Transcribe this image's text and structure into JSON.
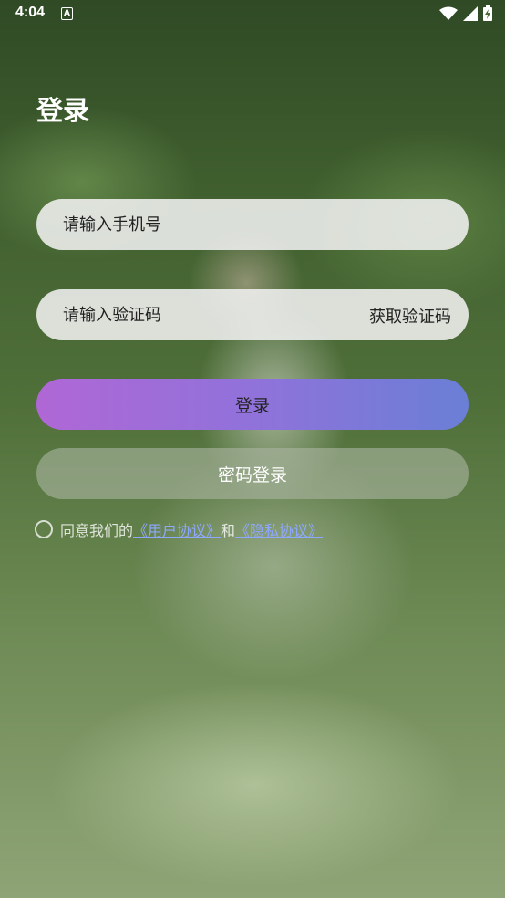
{
  "status_bar": {
    "time": "4:04",
    "notif_glyph": "A"
  },
  "title": "登录",
  "phone_input": {
    "placeholder": "请输入手机号"
  },
  "code_input": {
    "placeholder": "请输入验证码",
    "get_code_label": "获取验证码"
  },
  "login_button": {
    "label": "登录"
  },
  "password_login_button": {
    "label": "密码登录"
  },
  "agreement": {
    "prefix": "同意我们的",
    "user_agreement": "《用户协议》",
    "and": "和",
    "privacy_agreement": "《隐私协议》"
  },
  "colors": {
    "link": "#8ea8ff",
    "login_gradient_start": "#b067d6",
    "login_gradient_end": "#6a7fd6"
  },
  "icons": [
    "wifi-icon",
    "signal-icon",
    "battery-charging-icon",
    "notification-a-icon"
  ]
}
